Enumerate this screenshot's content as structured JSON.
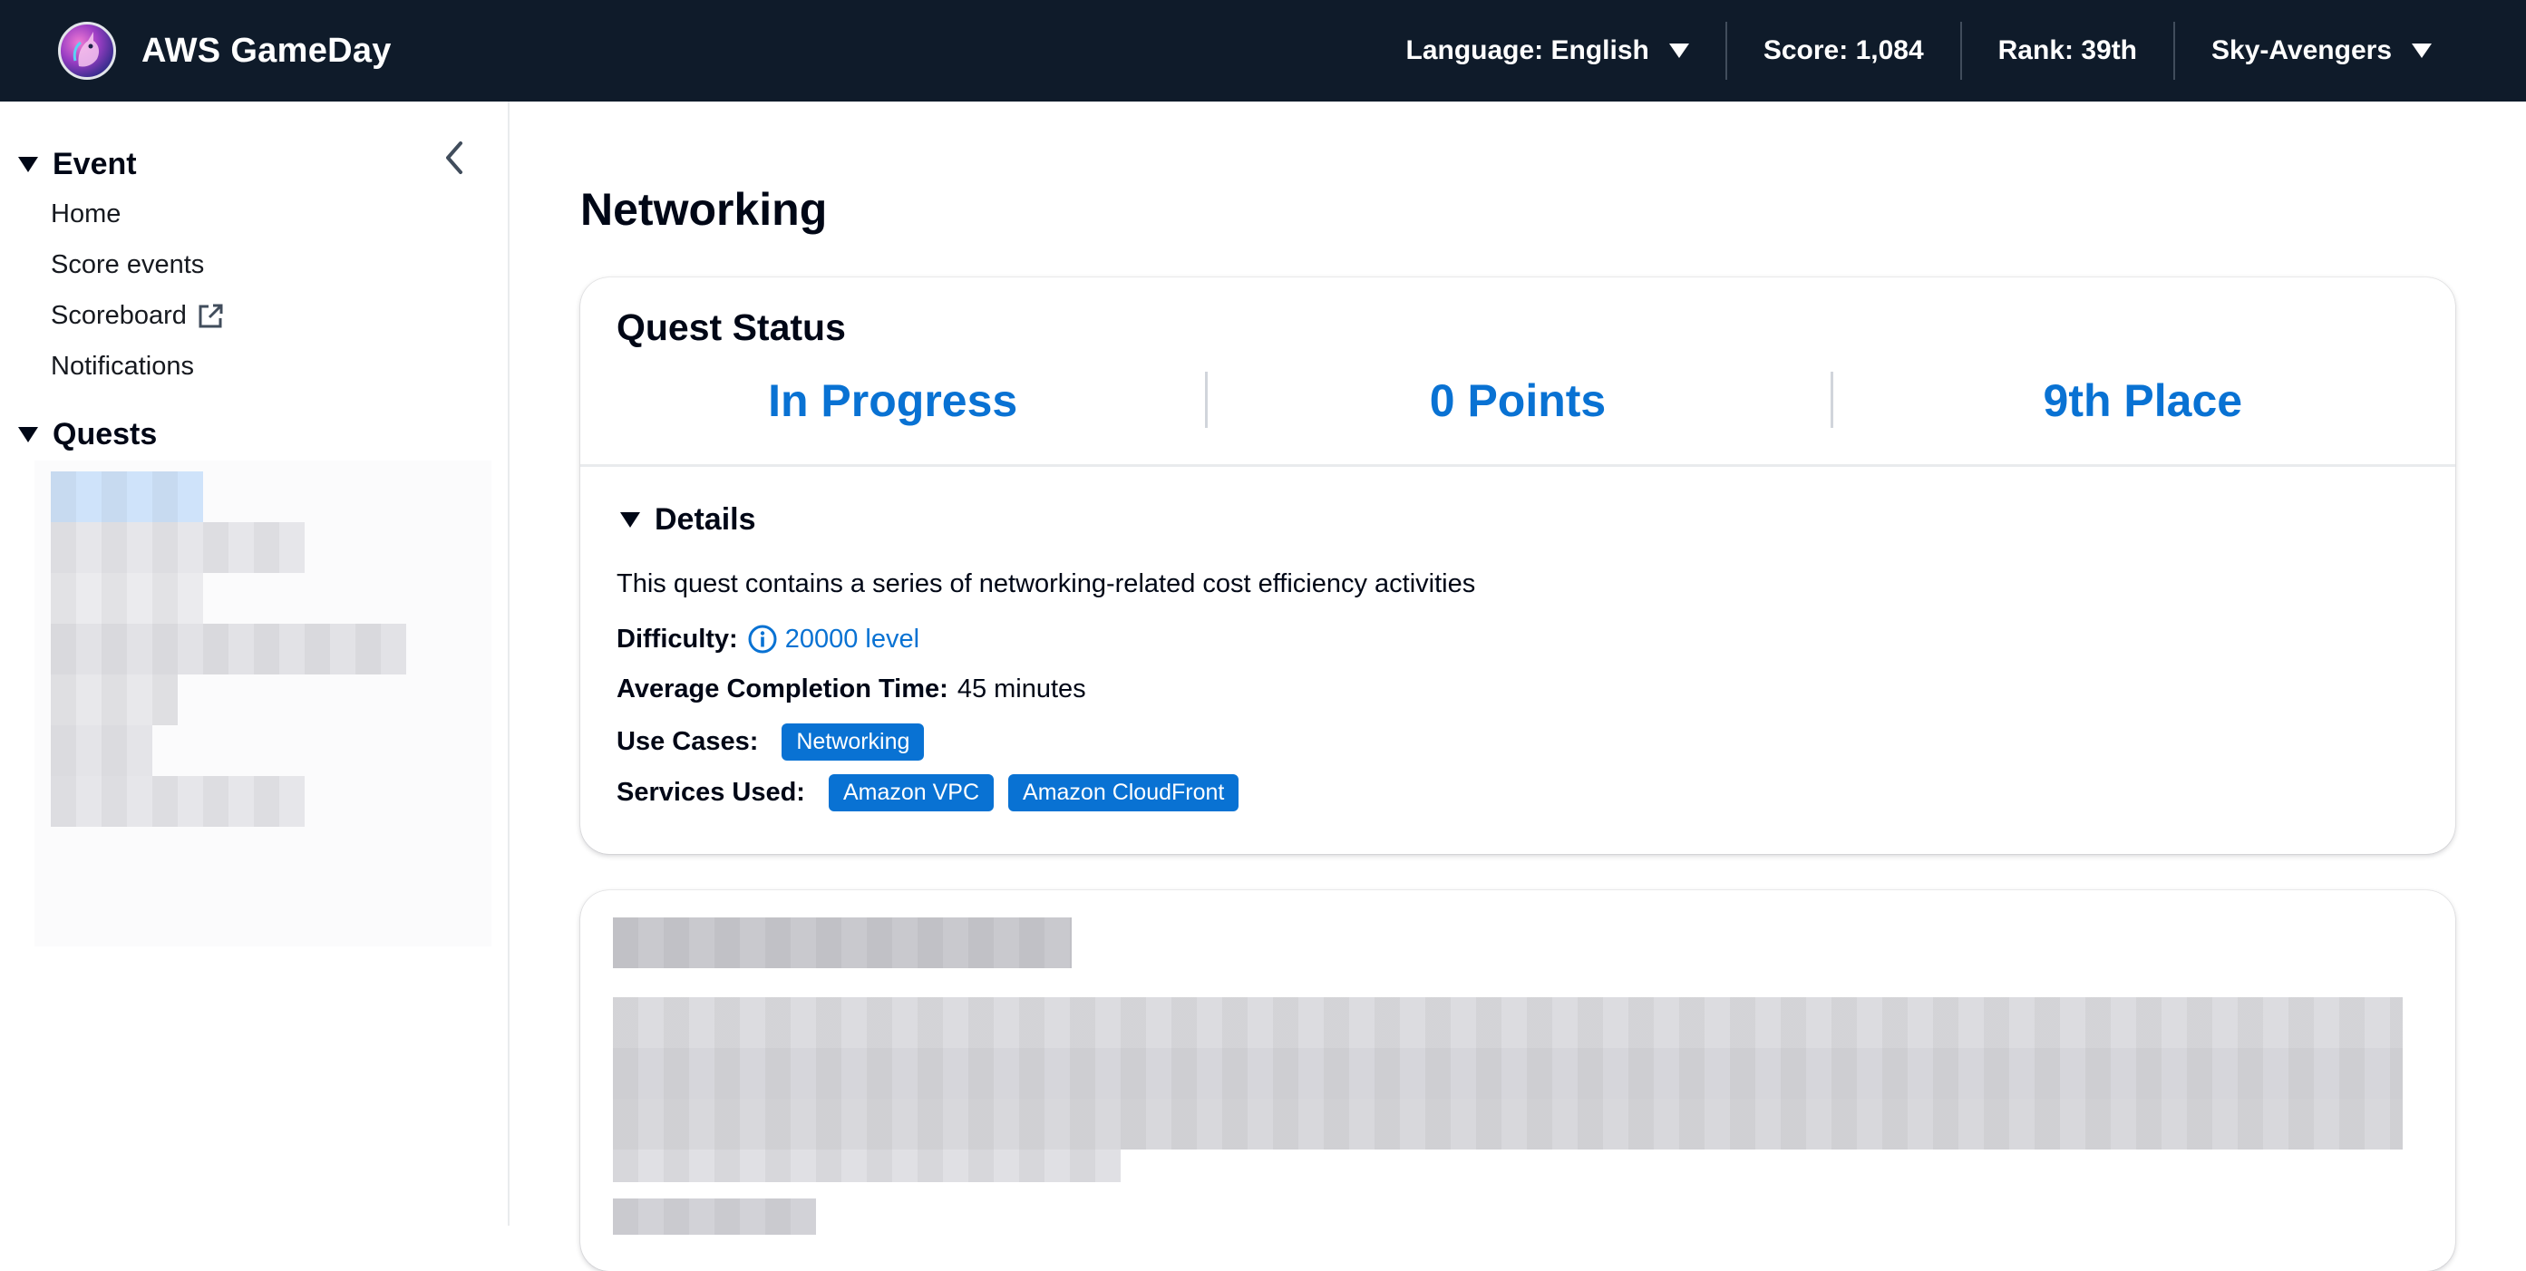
{
  "header": {
    "app_title": "AWS GameDay",
    "language": "Language: English",
    "score": "Score: 1,084",
    "rank": "Rank: 39th",
    "team": "Sky-Avengers"
  },
  "sidebar": {
    "event_section": "Event",
    "event_items": [
      "Home",
      "Score events",
      "Scoreboard",
      "Notifications"
    ],
    "quests_section": "Quests"
  },
  "main": {
    "page_title": "Networking",
    "quest_status": {
      "title": "Quest Status",
      "status": "In Progress",
      "points": "0 Points",
      "place": "9th Place"
    },
    "details": {
      "heading": "Details",
      "description": "This quest contains a series of networking-related cost efficiency activities",
      "difficulty_label": "Difficulty:",
      "difficulty_value": "20000 level",
      "avg_time_label": "Average Completion Time:",
      "avg_time_value": "45 minutes",
      "use_cases_label": "Use Cases:",
      "use_cases": [
        "Networking"
      ],
      "services_label": "Services Used:",
      "services": [
        "Amazon VPC",
        "Amazon CloudFront"
      ]
    }
  },
  "colors": {
    "header_bg": "#0f1b2a",
    "accent_blue": "#0972d3",
    "text": "#000716"
  }
}
